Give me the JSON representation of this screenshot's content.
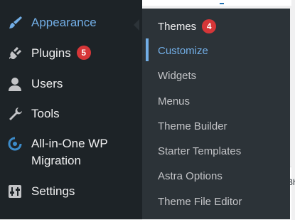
{
  "sidebar": {
    "items": [
      {
        "label": "Appearance",
        "icon": "paintbrush-icon",
        "current": true
      },
      {
        "label": "Plugins",
        "icon": "plug-icon",
        "badge": "5"
      },
      {
        "label": "Users",
        "icon": "user-icon"
      },
      {
        "label": "Tools",
        "icon": "wrench-icon"
      },
      {
        "label": "All-in-One WP",
        "label_line2": "Migration",
        "icon": "migration-icon"
      },
      {
        "label": "Settings",
        "icon": "settings-sliders-icon"
      }
    ]
  },
  "submenu": {
    "items": [
      {
        "label": "Themes",
        "badge": "4"
      },
      {
        "label": "Customize",
        "active": true
      },
      {
        "label": "Widgets"
      },
      {
        "label": "Menus"
      },
      {
        "label": "Theme Builder"
      },
      {
        "label": "Starter Templates"
      },
      {
        "label": "Astra Options"
      },
      {
        "label": "Theme File Editor"
      }
    ]
  },
  "content": {
    "peek_text": "Bh"
  },
  "colors": {
    "sidebar_bg": "#1d2327",
    "submenu_bg": "#2c3338",
    "accent": "#72aee6",
    "badge": "#d63638",
    "text": "#f0f0f1",
    "subtext": "#c3c4c7"
  }
}
